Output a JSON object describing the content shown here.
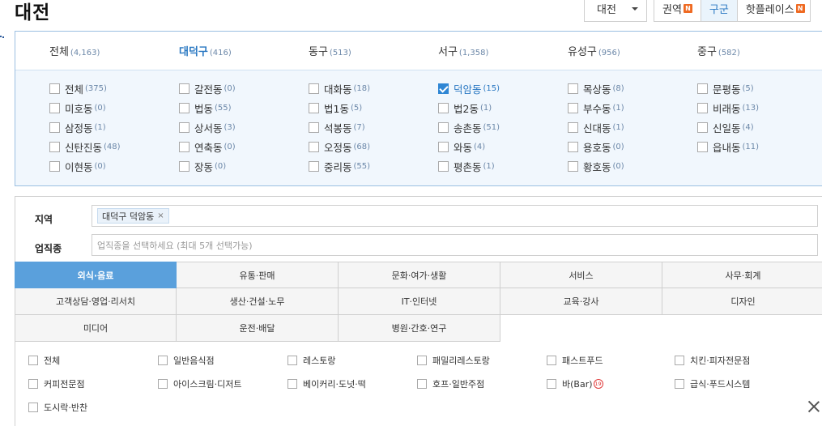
{
  "header": {
    "title": "대전",
    "city_select": "대전",
    "mode_tabs": [
      {
        "label": "권역",
        "badge": "N",
        "active": false
      },
      {
        "label": "구군",
        "badge": "",
        "active": true
      },
      {
        "label": "핫플레이스",
        "badge": "N",
        "active": false
      }
    ]
  },
  "gu_tabs": [
    {
      "name": "전체",
      "count": "(4,163)",
      "active": false
    },
    {
      "name": "대덕구",
      "count": "(416)",
      "active": true
    },
    {
      "name": "동구",
      "count": "(513)",
      "active": false
    },
    {
      "name": "서구",
      "count": "(1,358)",
      "active": false
    },
    {
      "name": "유성구",
      "count": "(956)",
      "active": false
    },
    {
      "name": "중구",
      "count": "(582)",
      "active": false
    }
  ],
  "dongs": [
    [
      {
        "name": "전체",
        "count": "(375)",
        "checked": false
      },
      {
        "name": "미호동",
        "count": "(0)",
        "checked": false
      },
      {
        "name": "삼정동",
        "count": "(1)",
        "checked": false
      },
      {
        "name": "신탄진동",
        "count": "(48)",
        "checked": false
      },
      {
        "name": "이현동",
        "count": "(0)",
        "checked": false
      }
    ],
    [
      {
        "name": "갈전동",
        "count": "(0)",
        "checked": false
      },
      {
        "name": "법동",
        "count": "(55)",
        "checked": false
      },
      {
        "name": "상서동",
        "count": "(3)",
        "checked": false
      },
      {
        "name": "연축동",
        "count": "(0)",
        "checked": false
      },
      {
        "name": "장동",
        "count": "(0)",
        "checked": false
      }
    ],
    [
      {
        "name": "대화동",
        "count": "(18)",
        "checked": false
      },
      {
        "name": "법1동",
        "count": "(5)",
        "checked": false
      },
      {
        "name": "석봉동",
        "count": "(7)",
        "checked": false
      },
      {
        "name": "오정동",
        "count": "(68)",
        "checked": false
      },
      {
        "name": "중리동",
        "count": "(55)",
        "checked": false
      }
    ],
    [
      {
        "name": "덕암동",
        "count": "(15)",
        "checked": true
      },
      {
        "name": "법2동",
        "count": "(1)",
        "checked": false
      },
      {
        "name": "송촌동",
        "count": "(51)",
        "checked": false
      },
      {
        "name": "와동",
        "count": "(4)",
        "checked": false
      },
      {
        "name": "평촌동",
        "count": "(1)",
        "checked": false
      }
    ],
    [
      {
        "name": "목상동",
        "count": "(8)",
        "checked": false
      },
      {
        "name": "부수동",
        "count": "(1)",
        "checked": false
      },
      {
        "name": "신대동",
        "count": "(1)",
        "checked": false
      },
      {
        "name": "용호동",
        "count": "(0)",
        "checked": false
      },
      {
        "name": "황호동",
        "count": "(0)",
        "checked": false
      }
    ],
    [
      {
        "name": "문평동",
        "count": "(5)",
        "checked": false
      },
      {
        "name": "비래동",
        "count": "(13)",
        "checked": false
      },
      {
        "name": "신일동",
        "count": "(4)",
        "checked": false
      },
      {
        "name": "읍내동",
        "count": "(11)",
        "checked": false
      }
    ]
  ],
  "filters": {
    "region_label": "지역",
    "region_tag": "대덕구 덕암동",
    "region_tag_remove": "×",
    "job_label": "업직종",
    "job_placeholder": "업직종을 선택하세요 (최대 5개 선택가능)"
  },
  "categories": [
    {
      "label": "외식·음료",
      "active": true
    },
    {
      "label": "유통·판매",
      "active": false
    },
    {
      "label": "문화·여가·생활",
      "active": false
    },
    {
      "label": "서비스",
      "active": false
    },
    {
      "label": "사무·회계",
      "active": false
    },
    {
      "label": "고객상담·영업·리서치",
      "active": false
    },
    {
      "label": "생산·건설·노무",
      "active": false
    },
    {
      "label": "IT·인터넷",
      "active": false
    },
    {
      "label": "교육·강사",
      "active": false
    },
    {
      "label": "디자인",
      "active": false
    },
    {
      "label": "미디어",
      "active": false
    },
    {
      "label": "운전·배달",
      "active": false
    },
    {
      "label": "병원·간호·연구",
      "active": false
    }
  ],
  "sub_categories": [
    [
      {
        "label": "전체"
      },
      {
        "label": "커피전문점"
      },
      {
        "label": "도시락·반찬"
      }
    ],
    [
      {
        "label": "일반음식점"
      },
      {
        "label": "아이스크림·디저트"
      }
    ],
    [
      {
        "label": "레스토랑"
      },
      {
        "label": "베이커리·도넛·떡"
      }
    ],
    [
      {
        "label": "패밀리레스토랑"
      },
      {
        "label": "호프·일반주점"
      }
    ],
    [
      {
        "label": "패스트푸드"
      },
      {
        "label": "바(Bar)",
        "badge": "19"
      }
    ],
    [
      {
        "label": "치킨·피자전문점"
      },
      {
        "label": "급식·푸드시스템"
      }
    ]
  ]
}
